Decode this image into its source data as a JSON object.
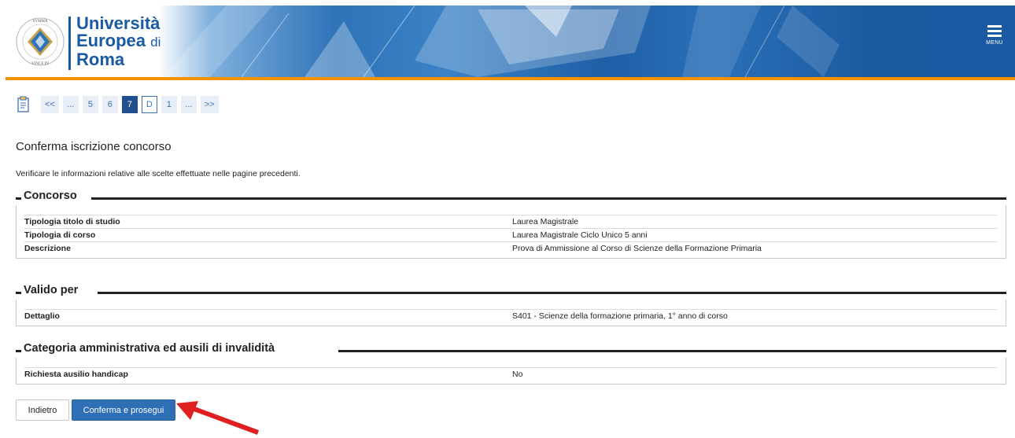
{
  "header": {
    "logo_line1": "Università",
    "logo_line2": "Europea",
    "logo_line2_suffix": "di",
    "logo_line3": "Roma",
    "seal_text": "VINCE IN BONO MALUM",
    "menu_label": "MENU",
    "accent_color": "#f39200",
    "brand_color": "#1a5aa3"
  },
  "pager": {
    "items": [
      "<<",
      "...",
      "5",
      "6",
      "7",
      "D",
      "1",
      "...",
      ">>"
    ],
    "active": "7",
    "icon": "clipboard-icon"
  },
  "page": {
    "title": "Conferma iscrizione concorso",
    "intro": "Verificare le informazioni relative alle scelte effettuate nelle pagine precedenti."
  },
  "sections": {
    "concorso": {
      "legend": "Concorso",
      "rows": [
        {
          "label": "Tipologia titolo di studio",
          "value": "Laurea Magistrale"
        },
        {
          "label": "Tipologia di corso",
          "value": "Laurea Magistrale Ciclo Unico 5 anni"
        },
        {
          "label": "Descrizione",
          "value": "Prova di Ammissione al Corso di Scienze della Formazione Primaria"
        }
      ]
    },
    "valido": {
      "legend": "Valido per",
      "rows": [
        {
          "label": "Dettaglio",
          "value": "S401 - Scienze della formazione primaria, 1° anno di corso"
        }
      ]
    },
    "categoria": {
      "legend": "Categoria amministrativa ed ausili di invalidità",
      "rows": [
        {
          "label": "Richiesta ausilio handicap",
          "value": "No"
        }
      ]
    }
  },
  "buttons": {
    "back": "Indietro",
    "next": "Conferma e prosegui",
    "next_color": "#2f6fb5",
    "arrow_color": "#e02020"
  }
}
